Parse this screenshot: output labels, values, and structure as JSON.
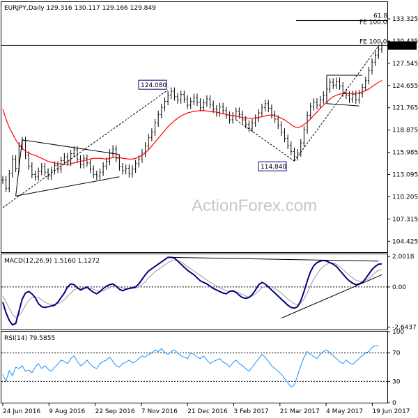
{
  "chart_data": [
    {
      "type": "ohlc",
      "header": "EURJPY,Daily  129.316 130.117 129.166 129.849",
      "symbol": "EURJPY",
      "timeframe": "Daily",
      "ohlc_last": {
        "open": 129.316,
        "high": 130.117,
        "low": 129.166,
        "close": 129.849
      },
      "ylim": [
        103.0,
        135.5
      ],
      "y_ticks": [
        "133.325",
        "130.435",
        "127.545",
        "124.655",
        "121.765",
        "118.875",
        "115.985",
        "113.095",
        "110.205",
        "107.315",
        "104.425"
      ],
      "current_price_label": "129.849",
      "x_ticks": [
        "24 Jun 2016",
        "9 Aug 2016",
        "22 Sep 2016",
        "7 Nov 2016",
        "21 Dec 2016",
        "3 Feb 2017",
        "21 Mar 2017",
        "4 May 2017",
        "19 Jun 2017"
      ],
      "annotations": [
        {
          "text": "124.080",
          "value": 124.08
        },
        {
          "text": "114.840",
          "value": 114.84
        },
        {
          "text": "61.8",
          "value": 134.1
        },
        {
          "text": "FE 100.0",
          "value": 133.55
        },
        {
          "text": "FE 100.0",
          "value": 129.849
        }
      ],
      "watermark": "ActionForex.com",
      "series": [
        {
          "values": [
            112.4,
            111.3,
            113.2,
            115.1,
            113.9,
            116.8,
            117.5,
            115.6,
            114.2,
            113.1,
            112.8,
            113.5,
            114.1,
            113.4,
            112.9,
            113.6,
            114.3,
            113.8,
            114.9,
            115.4,
            114.7,
            115.8,
            116.3,
            115.1,
            114.4,
            115.2,
            114.6,
            113.8,
            113.1,
            112.9,
            113.4,
            114.2,
            114.8,
            115.9,
            116.4,
            115.2,
            114.1,
            113.6,
            113.9,
            113.2,
            113.8,
            114.5,
            115.1,
            115.9,
            116.8,
            117.9,
            118.6,
            119.8,
            120.9,
            121.8,
            122.6,
            123.4,
            123.9,
            123.2,
            122.8,
            123.5,
            122.9,
            122.1,
            122.6,
            123.1,
            122.5,
            121.8,
            122.4,
            122.9,
            122.2,
            121.6,
            121.1,
            121.9,
            121.4,
            120.8,
            120.2,
            120.7,
            121.3,
            120.9,
            120.2,
            119.6,
            119.1,
            119.8,
            120.4,
            121.1,
            121.8,
            122.3,
            121.7,
            120.9,
            120.3,
            119.5,
            118.6,
            117.8,
            116.9,
            116.1,
            115.4,
            115.9,
            117.2,
            118.9,
            120.8,
            121.9,
            122.5,
            122.1,
            122.8,
            123.4,
            124.2,
            125.1,
            124.7,
            125.2,
            124.6,
            123.7,
            123.4,
            122.9,
            123.5,
            122.8,
            123.6,
            124.4,
            125.3,
            126.6,
            127.7,
            128.6,
            129.4,
            129.849
          ]
        },
        {
          "name": "SMA",
          "values": [
            121.6,
            120.3,
            119.2,
            118.4,
            117.6,
            117.0,
            116.5,
            116.1,
            115.9,
            115.7,
            115.6,
            115.4,
            115.2,
            115.0,
            114.8,
            114.7,
            114.6,
            114.5,
            114.45,
            114.4,
            114.4,
            114.5,
            114.6,
            114.7,
            114.8,
            114.9,
            115.0,
            115.1,
            115.2,
            115.2,
            115.2,
            115.15,
            115.1,
            115.2,
            115.3,
            115.3,
            115.3,
            115.2,
            115.15,
            115.1,
            115.1,
            115.2,
            115.35,
            115.6,
            115.9,
            116.3,
            116.8,
            117.3,
            117.8,
            118.3,
            118.8,
            119.3,
            119.7,
            120.1,
            120.4,
            120.7,
            120.9,
            121.1,
            121.2,
            121.3,
            121.35,
            121.4,
            121.4,
            121.35,
            121.3,
            121.25,
            121.2,
            121.1,
            121.0,
            120.9,
            120.8,
            120.75,
            120.7,
            120.6,
            120.5,
            120.45,
            120.4,
            120.4,
            120.45,
            120.5,
            120.6,
            120.7,
            120.8,
            120.8,
            120.75,
            120.6,
            120.4,
            120.2,
            119.9,
            119.6,
            119.3,
            119.2,
            119.3,
            119.6,
            119.9,
            120.3,
            120.8,
            121.2,
            121.7,
            122.1,
            122.5,
            122.9,
            123.2,
            123.4,
            123.55,
            123.6,
            123.6,
            123.6,
            123.6,
            123.65,
            123.7,
            123.8,
            124.0,
            124.2,
            124.5,
            124.8,
            125.1,
            125.3
          ]
        }
      ]
    },
    {
      "type": "line",
      "header": "MACD(12,26,9) 1.5160 1.1272",
      "ylim": [
        -2.8,
        2.15
      ],
      "y_ticks": [
        "2.0018",
        "0.00",
        "-2.6437"
      ],
      "series": [
        {
          "name": "MACD",
          "values": [
            -1.0,
            -1.7,
            -2.2,
            -2.5,
            -2.4,
            -1.6,
            -0.8,
            -0.4,
            -0.3,
            -0.45,
            -0.7,
            -1.1,
            -1.3,
            -1.35,
            -1.3,
            -1.25,
            -1.2,
            -1.0,
            -0.7,
            -0.4,
            0.0,
            0.2,
            0.15,
            -0.05,
            -0.2,
            -0.1,
            0.0,
            -0.2,
            -0.35,
            -0.45,
            -0.3,
            -0.1,
            0.05,
            0.15,
            0.2,
            0.05,
            -0.15,
            -0.25,
            -0.15,
            -0.1,
            -0.05,
            0.0,
            0.2,
            0.5,
            0.8,
            1.05,
            1.2,
            1.35,
            1.5,
            1.65,
            1.8,
            1.95,
            1.95,
            1.9,
            1.7,
            1.5,
            1.3,
            1.1,
            0.95,
            0.8,
            0.6,
            0.4,
            0.3,
            0.2,
            0.05,
            -0.1,
            -0.2,
            -0.3,
            -0.4,
            -0.45,
            -0.3,
            -0.25,
            -0.35,
            -0.55,
            -0.7,
            -0.75,
            -0.7,
            -0.5,
            -0.2,
            0.15,
            0.3,
            0.2,
            0.0,
            -0.2,
            -0.4,
            -0.6,
            -0.8,
            -1.0,
            -1.2,
            -1.35,
            -1.4,
            -1.3,
            -0.9,
            -0.3,
            0.4,
            1.0,
            1.4,
            1.6,
            1.7,
            1.75,
            1.7,
            1.6,
            1.5,
            1.35,
            1.1,
            0.85,
            0.6,
            0.4,
            0.25,
            0.15,
            0.2,
            0.3,
            0.55,
            0.85,
            1.15,
            1.35,
            1.5,
            1.52
          ]
        },
        {
          "name": "Signal",
          "values": [
            -0.6,
            -1.0,
            -1.4,
            -1.8,
            -2.0,
            -1.9,
            -1.6,
            -1.2,
            -0.9,
            -0.7,
            -0.65,
            -0.7,
            -0.85,
            -1.0,
            -1.1,
            -1.15,
            -1.15,
            -1.1,
            -1.0,
            -0.85,
            -0.6,
            -0.4,
            -0.2,
            -0.1,
            -0.1,
            -0.1,
            -0.08,
            -0.1,
            -0.15,
            -0.25,
            -0.3,
            -0.25,
            -0.15,
            -0.05,
            0.05,
            0.05,
            0.0,
            -0.08,
            -0.12,
            -0.12,
            -0.1,
            -0.08,
            0.0,
            0.15,
            0.35,
            0.6,
            0.8,
            1.0,
            1.15,
            1.3,
            1.45,
            1.6,
            1.7,
            1.78,
            1.75,
            1.65,
            1.5,
            1.35,
            1.2,
            1.05,
            0.9,
            0.75,
            0.6,
            0.45,
            0.3,
            0.2,
            0.05,
            -0.05,
            -0.15,
            -0.25,
            -0.3,
            -0.3,
            -0.32,
            -0.4,
            -0.5,
            -0.6,
            -0.65,
            -0.6,
            -0.45,
            -0.25,
            -0.05,
            0.05,
            0.05,
            0.0,
            -0.1,
            -0.25,
            -0.4,
            -0.6,
            -0.8,
            -0.95,
            -1.1,
            -1.2,
            -1.1,
            -0.8,
            -0.4,
            0.1,
            0.5,
            0.85,
            1.15,
            1.35,
            1.5,
            1.58,
            1.58,
            1.5,
            1.35,
            1.15,
            0.95,
            0.75,
            0.6,
            0.45,
            0.38,
            0.35,
            0.42,
            0.55,
            0.75,
            0.95,
            1.1,
            1.13
          ]
        }
      ]
    },
    {
      "type": "line",
      "header": "RSI(14) 79.5855",
      "ylim": [
        0,
        100
      ],
      "y_ticks": [
        "100",
        "70",
        "30",
        "0"
      ],
      "series": [
        {
          "name": "RSI",
          "values": [
            40,
            30,
            45,
            38,
            50,
            48,
            52,
            44,
            46,
            42,
            50,
            55,
            48,
            52,
            47,
            44,
            50,
            54,
            60,
            58,
            55,
            62,
            66,
            58,
            52,
            55,
            60,
            54,
            50,
            48,
            55,
            58,
            60,
            64,
            58,
            52,
            50,
            55,
            57,
            60,
            56,
            58,
            62,
            66,
            64,
            68,
            70,
            74,
            72,
            76,
            71,
            68,
            72,
            74,
            70,
            66,
            64,
            62,
            70,
            68,
            64,
            62,
            66,
            60,
            55,
            58,
            60,
            62,
            57,
            55,
            50,
            56,
            60,
            55,
            52,
            48,
            44,
            50,
            56,
            62,
            68,
            64,
            58,
            52,
            48,
            44,
            40,
            34,
            28,
            22,
            25,
            38,
            52,
            64,
            72,
            68,
            65,
            62,
            68,
            72,
            74,
            70,
            66,
            62,
            58,
            55,
            60,
            56,
            54,
            58,
            62,
            66,
            70,
            72,
            78,
            80,
            79.59
          ]
        }
      ]
    }
  ]
}
